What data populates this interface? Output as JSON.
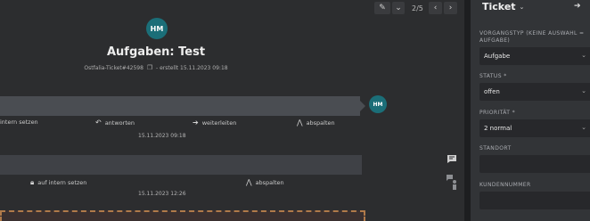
{
  "toolbar": {
    "edit_icon": "pencil-icon",
    "menu_icon": "chevron-down-icon",
    "pager": "2/5",
    "prev_icon": "chevron-left-icon",
    "next_icon": "chevron-right-icon"
  },
  "header": {
    "avatar_initials": "HM",
    "title": "Aufgaben: Test",
    "ticket_ref": "Ostfalia-Ticket#42598",
    "created": "- erstellt 15.11.2023 09:18"
  },
  "article1": {
    "avatar_initials": "HM",
    "actions": {
      "internal": "intern setzen",
      "reply": "antworten",
      "forward": "weiterleiten",
      "split": "abspalten"
    },
    "timestamp": "15.11.2023 09:18"
  },
  "article2": {
    "actions": {
      "internal": "auf intern setzen",
      "split": "abspalten"
    },
    "timestamp": "15.11.2023 12:26"
  },
  "sidebar": {
    "title": "Ticket",
    "fields": [
      {
        "label": "VORGANGSTYP (KEINE AUSWAHL = AUFGABE)",
        "value": "Aufgabe"
      },
      {
        "label": "STATUS *",
        "value": "offen"
      },
      {
        "label": "PRIORITÄT *",
        "value": "2 normal"
      },
      {
        "label": "STANDORT",
        "value": ""
      },
      {
        "label": "KUNDENNUMMER",
        "value": ""
      }
    ]
  },
  "colors": {
    "accent": "#1b6e78",
    "background": "#2c2d2f",
    "sidebar": "#323437"
  }
}
